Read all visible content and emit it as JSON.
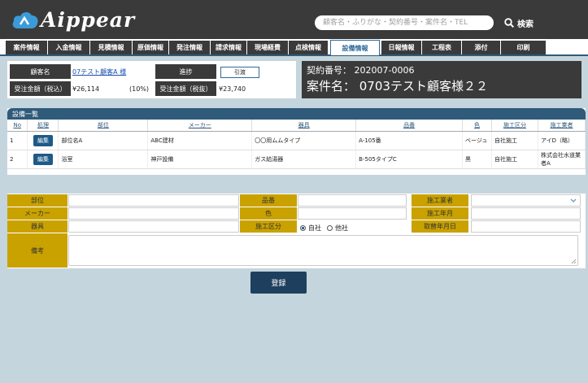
{
  "app": {
    "logo_text": "Aippear"
  },
  "search": {
    "placeholder": "顧客名・ふりがな・契約番号・案件名・TEL",
    "button_label": "検索"
  },
  "tabs": [
    {
      "label": "案件情報"
    },
    {
      "label": "入金情報"
    },
    {
      "label": "見積情報"
    },
    {
      "label": "原価情報"
    },
    {
      "label": "発注情報"
    },
    {
      "label": "請求情報"
    },
    {
      "label": "現場経費"
    },
    {
      "label": "点検情報"
    },
    {
      "label": "設備情報",
      "active": true
    },
    {
      "label": "日報情報"
    },
    {
      "label": "工程表"
    },
    {
      "label": "添付"
    },
    {
      "label": "印刷"
    }
  ],
  "info": {
    "customer_label": "顧客名",
    "customer_value": "07テスト顧客A 様",
    "progress_label": "進捗",
    "progress_value": "引渡",
    "amount_incl_label": "受注金額（税込）",
    "amount_incl_value": "¥26,114",
    "tax_rate": "(10%)",
    "amount_excl_label": "受注金額（税抜）",
    "amount_excl_value": "¥23,740",
    "contract_no": "契約番号： 202007-0006",
    "case_name": "案件名： 0703テスト顧客様２２"
  },
  "equipment": {
    "title": "設備一覧",
    "columns": [
      "No",
      "処理",
      "部位",
      "メーカー",
      "器具",
      "品番",
      "色",
      "施工区分",
      "施工業者"
    ],
    "edit_label": "編集",
    "rows": [
      {
        "no": "1",
        "part": "部位名A",
        "maker": "ABC建材",
        "fixture": "〇〇用ムムタイプ",
        "model": "A-105番",
        "color": "ベージュ",
        "division": "自社施工",
        "contractor": "アイD（略）"
      },
      {
        "no": "2",
        "part": "浴室",
        "maker": "神戸設備",
        "fixture": "ガス給湯器",
        "model": "B-505タイプC",
        "color": "黒",
        "division": "自社施工",
        "contractor": "株式会社水道業者A"
      }
    ]
  },
  "form": {
    "part_label": "部位",
    "model_label": "品番",
    "contractor_label": "施工業者",
    "maker_label": "メーカー",
    "color_label": "色",
    "install_date_label": "施工年月",
    "fixture_label": "器具",
    "division_label": "施工区分",
    "division_options": [
      "自社",
      "他社"
    ],
    "replace_date_label": "取替年月日",
    "remarks_label": "備考",
    "submit_label": "登録"
  },
  "colors": {
    "header": "#3a3a3a",
    "accent": "#2f5a7a",
    "label_gold": "#c9a200",
    "page_bg": "#c5d5dd"
  }
}
